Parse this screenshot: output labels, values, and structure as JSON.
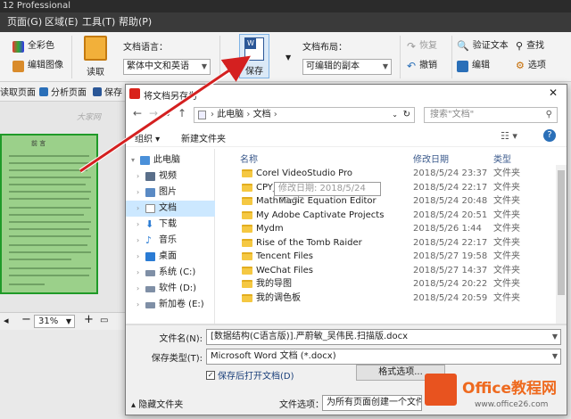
{
  "app": {
    "title": "12 Professional"
  },
  "menu": [
    "页面(G)",
    "区域(E)",
    "工具(T)",
    "帮助(P)"
  ],
  "ribbon": {
    "full_color": "全彩色",
    "edit_image": "编辑图像",
    "read": "读取",
    "doc_language_label": "文档语言：",
    "doc_language_value": "繁体中文和英语",
    "save": "保存",
    "doc_layout_label": "文档布局：",
    "doc_layout_value": "可编辑的副本",
    "restore": "恢复",
    "undo": "撤销",
    "verify_text": "验证文本",
    "edit": "编辑",
    "find": "查找",
    "options": "选项"
  },
  "toolbar2": {
    "read_page": "读取页面",
    "analyze_page": "分析页面",
    "save_page": "保存"
  },
  "doc": {
    "heading": "前 言",
    "watermark": "大家网"
  },
  "zoom": {
    "value": "31%"
  },
  "dialog": {
    "title": "将文档另存为",
    "breadcrumb": [
      "此电脑",
      "文档"
    ],
    "search_placeholder": "搜索\"文档\"",
    "organize": "组织",
    "new_folder": "新建文件夹",
    "tree": [
      {
        "label": "此电脑",
        "icon": "pc-icon",
        "color": "#4a90d9"
      },
      {
        "label": "视频",
        "icon": "video-folder-icon",
        "color": "#5a6f8a"
      },
      {
        "label": "图片",
        "icon": "pictures-folder-icon",
        "color": "#5a8ac4"
      },
      {
        "label": "文档",
        "icon": "documents-folder-icon",
        "color": "#8a8a8a"
      },
      {
        "label": "下载",
        "icon": "download-icon",
        "color": "#2a7bd4"
      },
      {
        "label": "音乐",
        "icon": "music-icon",
        "color": "#2a7bd4"
      },
      {
        "label": "桌面",
        "icon": "desktop-icon",
        "color": "#2a7bd4"
      },
      {
        "label": "系统 (C:)",
        "icon": "drive-icon",
        "color": "#7f8fa6"
      },
      {
        "label": "软件 (D:)",
        "icon": "drive-icon",
        "color": "#7f8fa6"
      },
      {
        "label": "新加卷 (E:)",
        "icon": "drive-icon",
        "color": "#7f8fa6"
      }
    ],
    "columns": {
      "name": "名称",
      "modified": "修改日期",
      "type": "类型"
    },
    "files": [
      {
        "name": "Corel VideoStudio Pro",
        "date": "2018/5/24 23:37",
        "type": "文件夹"
      },
      {
        "name": "CPY_SAVES",
        "date": "2018/5/24 22:17",
        "type": "文件夹"
      },
      {
        "name": "MathMagic Equation Editor",
        "date": "2018/5/24 20:48",
        "type": "文件夹"
      },
      {
        "name": "My Adobe Captivate Projects",
        "date": "2018/5/24 20:51",
        "type": "文件夹"
      },
      {
        "name": "Mydm",
        "date": "2018/5/26 1:44",
        "type": "文件夹"
      },
      {
        "name": "Rise of the Tomb Raider",
        "date": "2018/5/24 22:17",
        "type": "文件夹"
      },
      {
        "name": "Tencent Files",
        "date": "2018/5/27 19:58",
        "type": "文件夹"
      },
      {
        "name": "WeChat Files",
        "date": "2018/5/27 14:37",
        "type": "文件夹"
      },
      {
        "name": "我的导图",
        "date": "2018/5/24 20:22",
        "type": "文件夹"
      },
      {
        "name": "我的调色板",
        "date": "2018/5/24 20:59",
        "type": "文件夹"
      }
    ],
    "tooltip": "修改日期: 2018/5/24 23:37",
    "filename_label": "文件名(N):",
    "filename_value": "[数据结构(C语言版)].严蔚敏_吴伟民.扫描版.docx",
    "savetype_label": "保存类型(T):",
    "savetype_value": "Microsoft Word 文档 (*.docx)",
    "open_after_save": "保存后打开文档(D)",
    "format_options": "格式选项...",
    "hide_folders": "隐藏文件夹",
    "file_options_label": "文件选项：",
    "file_options_value": "为所有页面创建一个文件"
  },
  "watermark_logo": {
    "text": "Office教程网",
    "url": "www.office26.com"
  }
}
